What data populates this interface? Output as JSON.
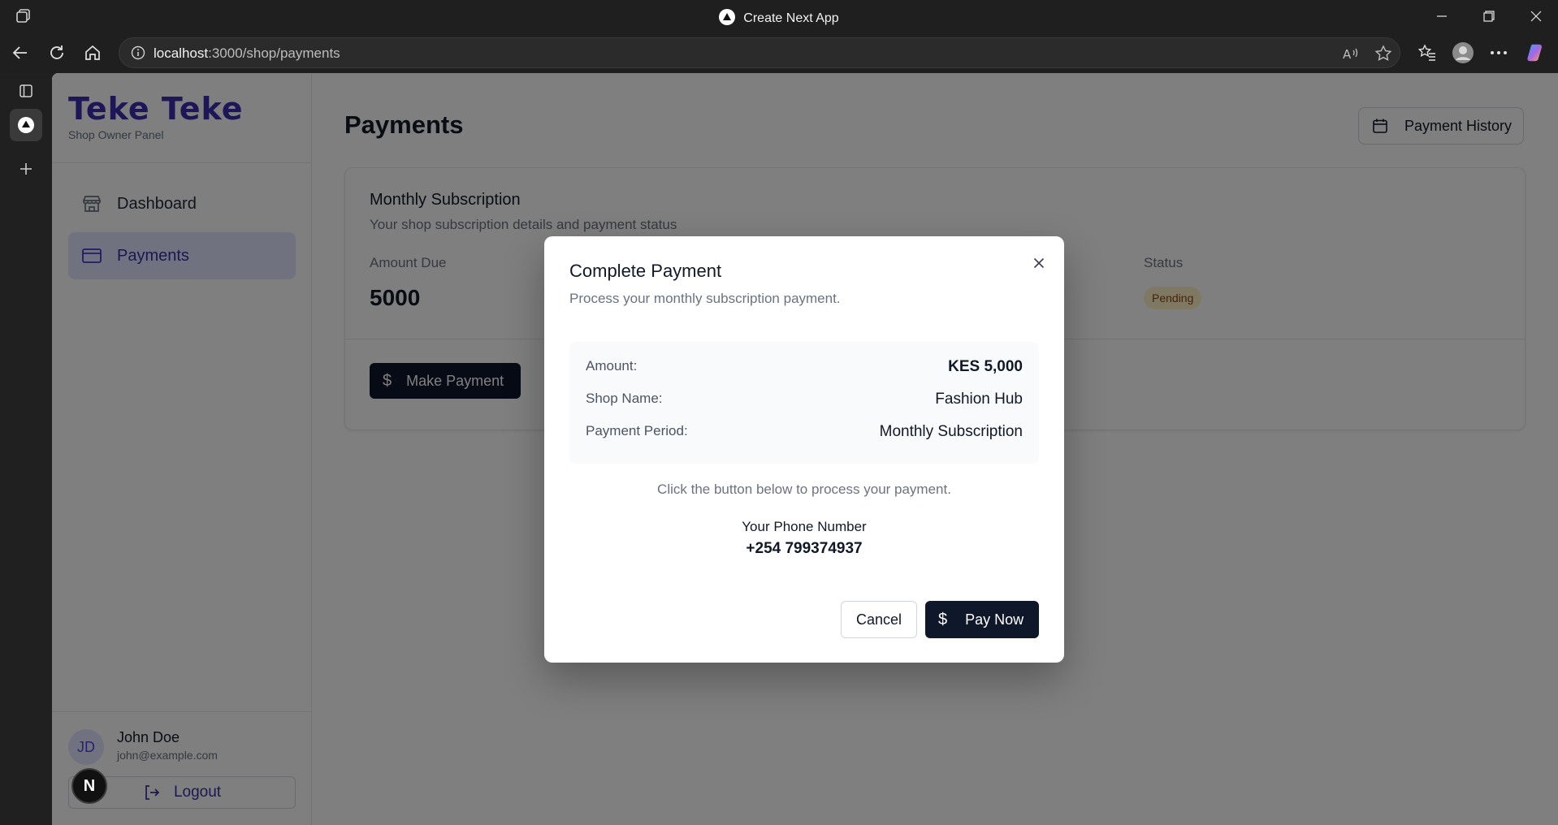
{
  "browser": {
    "tab_title": "Create Next App",
    "url_host": "localhost",
    "url_rest": ":3000/shop/payments"
  },
  "sidebar": {
    "brand": "Teke Teke",
    "brand_sub": "Shop Owner Panel",
    "items": [
      {
        "label": "Dashboard",
        "icon": "store-icon"
      },
      {
        "label": "Payments",
        "icon": "credit-card-icon",
        "active": true
      }
    ],
    "user": {
      "initials": "JD",
      "name": "John Doe",
      "email": "john@example.com"
    },
    "logout_label": "Logout",
    "next_badge": "N"
  },
  "main": {
    "title": "Payments",
    "history_button": "Payment History",
    "card": {
      "title": "Monthly Subscription",
      "description": "Your shop subscription details and payment status",
      "amount_label": "Amount Due",
      "amount_value": "5000",
      "status_label": "Status",
      "status_value": "Pending",
      "make_payment": "Make Payment",
      "dollar_glyph": "$"
    }
  },
  "modal": {
    "title": "Complete Payment",
    "description": "Process your monthly subscription payment.",
    "rows": [
      {
        "key": "Amount:",
        "value": "KES 5,000"
      },
      {
        "key": "Shop Name:",
        "value": "Fashion Hub"
      },
      {
        "key": "Payment Period:",
        "value": "Monthly Subscription"
      }
    ],
    "hint": "Click the button below to process your payment.",
    "phone_label": "Your Phone Number",
    "phone_value": "+254 799374937",
    "cancel": "Cancel",
    "pay_now": "Pay Now",
    "dollar_glyph": "$"
  },
  "colors": {
    "brand": "#3b2fb0",
    "primary_button": "#0f172a",
    "active_nav": "#e0e7ff",
    "pending_badge": "#fef3c7"
  }
}
